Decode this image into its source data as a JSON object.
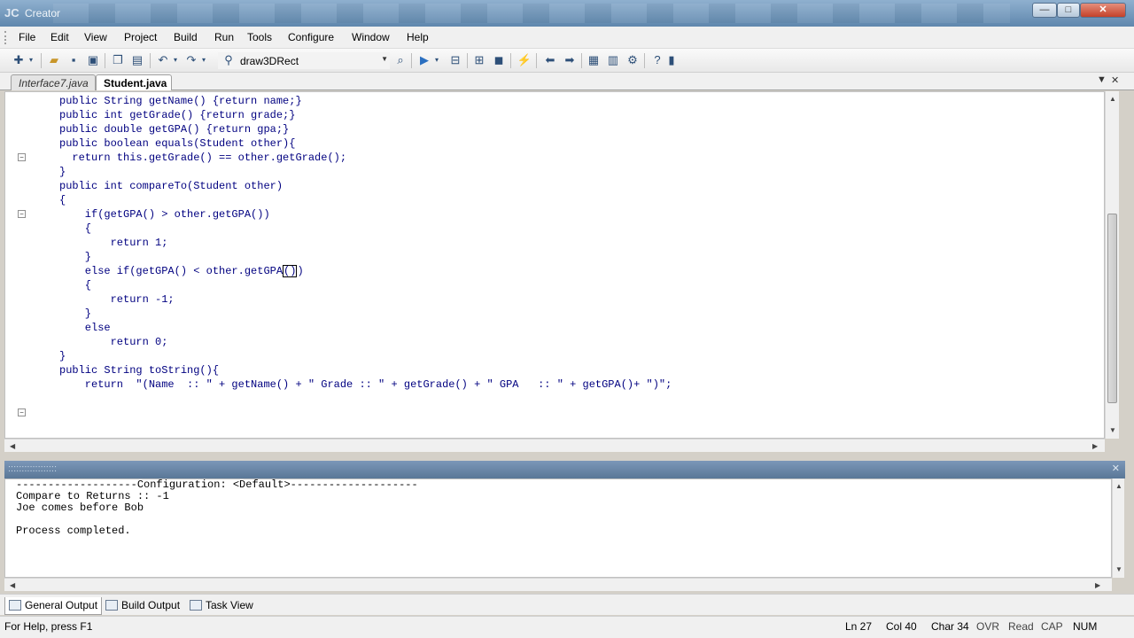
{
  "window": {
    "title": "Creator"
  },
  "menu": [
    "File",
    "Edit",
    "View",
    "Project",
    "Build",
    "Run",
    "Tools",
    "Configure",
    "Window",
    "Help"
  ],
  "toolbar": {
    "run_target": "draw3DRect"
  },
  "tabs": [
    {
      "label": "Interface7.java",
      "active": false
    },
    {
      "label": "Student.java",
      "active": true
    }
  ],
  "editor": {
    "lines": [
      "public String getName() {return name;}",
      "public int getGrade() {return grade;}",
      "public double getGPA() {return gpa;}",
      "",
      "public boolean equals(Student other){",
      "  return this.getGrade() == other.getGrade();",
      "}",
      "",
      "public int compareTo(Student other)",
      "{",
      "    if(getGPA() > other.getGPA())",
      "    {",
      "        return 1;",
      "    }",
      "    else if(getGPA() < other.getGPA",
      "    {",
      "        return -1;",
      "    }",
      "    else",
      "        return 0;",
      "}",
      "",
      "public String toString(){",
      "    return  \"(Name  :: \" + getName() + \" Grade :: \" + getGrade() + \" GPA   :: \" + getGPA()+ \")\";"
    ],
    "caret_tail": "()",
    "caret_after": ")"
  },
  "output": {
    "lines": [
      "-------------------Configuration: <Default>--------------------",
      "Compare to Returns :: -1",
      "Joe comes before Bob",
      "",
      "Process completed."
    ]
  },
  "output_tabs": [
    {
      "label": "General Output",
      "active": true
    },
    {
      "label": "Build Output",
      "active": false
    },
    {
      "label": "Task View",
      "active": false
    }
  ],
  "status": {
    "help": "For Help, press F1",
    "ln": "Ln 27",
    "col": "Col 40",
    "char": "Char 34",
    "ovr": "OVR",
    "read": "Read",
    "cap": "CAP",
    "num": "NUM"
  },
  "colors": {
    "code_text": "#000080",
    "title_bar": "#5f87ad"
  }
}
